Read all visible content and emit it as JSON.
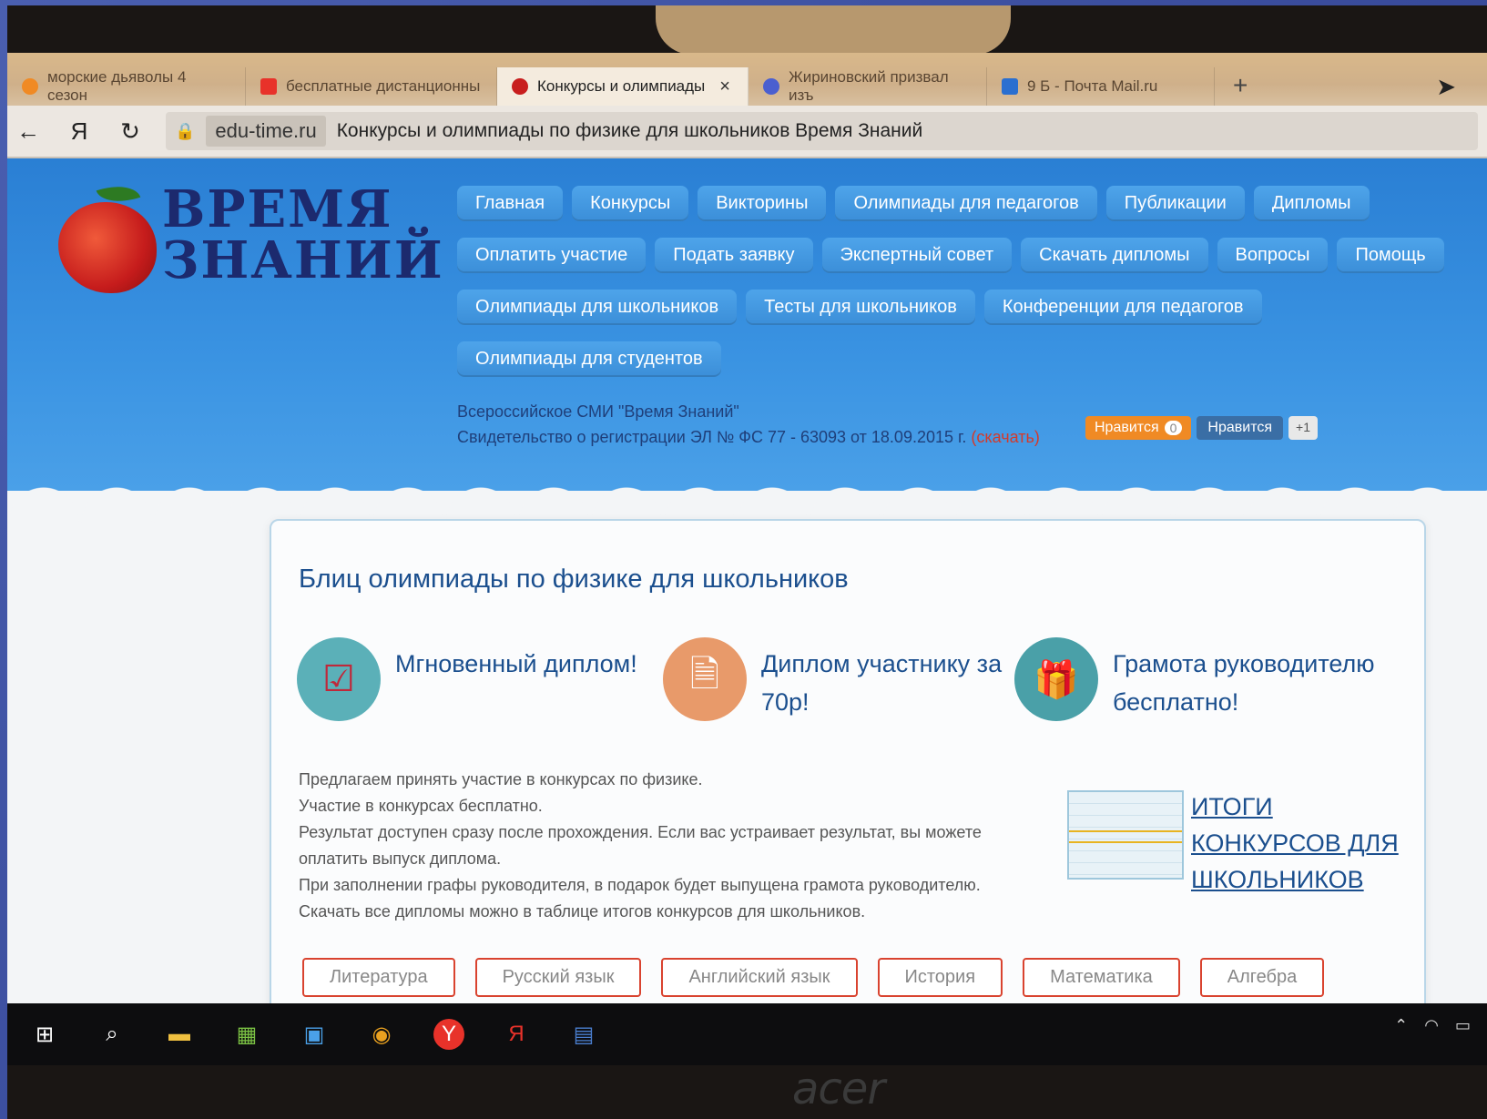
{
  "browser": {
    "tabs": [
      {
        "label": "морские дьяволы 4 сезон",
        "fav_color": "#f08a24",
        "active": false
      },
      {
        "label": "бесплатные дистанционны",
        "fav_color": "#e8322a",
        "active": false
      },
      {
        "label": "Конкурсы и олимпиады",
        "fav_color": "#c81e1e",
        "active": true
      },
      {
        "label": "Жириновский призвал изъ",
        "fav_color": "#4a5fd0",
        "active": false
      },
      {
        "label": "9 Б - Почта Mail.ru",
        "fav_color": "#2a6fd0",
        "active": false
      }
    ],
    "close_glyph": "×",
    "new_tab_glyph": "+",
    "back_glyph": "←",
    "yandex_glyph": "Я",
    "reload_glyph": "↻",
    "lock_glyph": "🔒",
    "domain": "edu-time.ru",
    "page_title": "Конкурсы и олимпиады по физике для школьников Время Знаний"
  },
  "site": {
    "logo_line1": "ВРЕМЯ",
    "logo_line2": "ЗНАНИЙ",
    "menu_rows": [
      [
        "Главная",
        "Конкурсы",
        "Викторины",
        "Олимпиады для педагогов",
        "Публикации",
        "Дипломы"
      ],
      [
        "Оплатить участие",
        "Подать заявку",
        "Экспертный совет",
        "Скачать дипломы",
        "Вопросы",
        "Помощь"
      ],
      [
        "Олимпиады для школьников",
        "Тесты для школьников",
        "Конференции для педагогов"
      ],
      [
        "Олимпиады для студентов"
      ]
    ],
    "media_name": "Всероссийское СМИ \"Время Знаний\"",
    "registration": "Свидетельство о регистрации ЭЛ № ФС 77 - 63093 от 18.09.2015 г.",
    "download_link": "(скачать)",
    "like_ok": "Нравится",
    "like_ok_count": "0",
    "like_vk": "Нравится",
    "plus_one": "+1"
  },
  "card": {
    "title": "Блиц олимпиады по физике для школьников",
    "features": [
      {
        "icon": "checkbox-icon",
        "text": "Мгновенный диплом!",
        "color": "#5bb0b8"
      },
      {
        "icon": "document-icon",
        "text": "Диплом участнику за 70р!",
        "color": "#e89a6a"
      },
      {
        "icon": "gift-icon",
        "text": "Грамота руководителю бесплатно!",
        "color": "#4aa0a8"
      }
    ],
    "description": [
      "Предлагаем принять участие в конкурсах по физике.",
      "Участие в конкурсах бесплатно.",
      "Результат доступен сразу после прохождения. Если вас устраивает результат, вы можете оплатить выпуск диплома.",
      "При заполнении графы руководителя, в подарок будет выпущена грамота руководителю.",
      "Скачать все дипломы можно в таблице итогов конкурсов для школьников."
    ],
    "results_link": "ИТОГИ КОНКУРСОВ ДЛЯ ШКОЛЬНИКОВ",
    "subjects": [
      "Литература",
      "Русский язык",
      "Английский язык",
      "История",
      "Математика",
      "Алгебра"
    ]
  },
  "taskbar": {
    "icons": [
      "windows-start-icon",
      "search-icon",
      "file-explorer-icon",
      "store-icon",
      "photos-icon",
      "chrome-icon",
      "yandex-browser-icon",
      "yandex-icon",
      "word-icon"
    ],
    "brand": "acer"
  }
}
